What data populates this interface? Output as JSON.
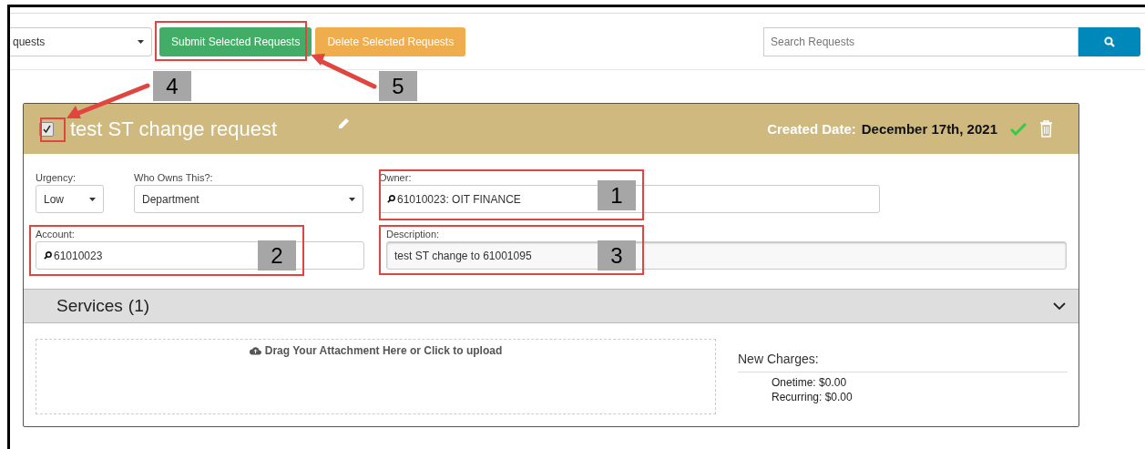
{
  "toolbar": {
    "filter_value": "quests",
    "buttons": [
      {
        "label": "Submit Selected Requests",
        "kind": "submit"
      },
      {
        "label": "Delete Selected Requests",
        "kind": "delete"
      }
    ],
    "search": {
      "placeholder": "Search Requests"
    }
  },
  "request": {
    "checked": true,
    "title": "test ST change request",
    "created_label": "Created Date:",
    "created_date": "December 17th, 2021",
    "fields": [
      {
        "label": "Urgency:",
        "value": "Low",
        "kind": "select"
      },
      {
        "label": "Who Owns This?:",
        "value": "Department",
        "kind": "select"
      },
      {
        "label": "Owner:",
        "value": "61010023: OIT FINANCE",
        "kind": "lookup"
      },
      {
        "label": "Account:",
        "value": "61010023",
        "kind": "lookup"
      },
      {
        "label": "Description:",
        "value": "test ST change to 61001095",
        "kind": "text"
      }
    ],
    "services": {
      "title": "Services",
      "count": "(1)",
      "expanded": true
    },
    "upload": {
      "label": "Drag Your Attachment Here or Click to upload"
    },
    "charges": {
      "title": "New Charges:",
      "lines": [
        "Onetime: $0.00",
        "Recurring: $0.00"
      ]
    }
  },
  "callouts": [
    "4",
    "5",
    "1",
    "2",
    "3"
  ]
}
